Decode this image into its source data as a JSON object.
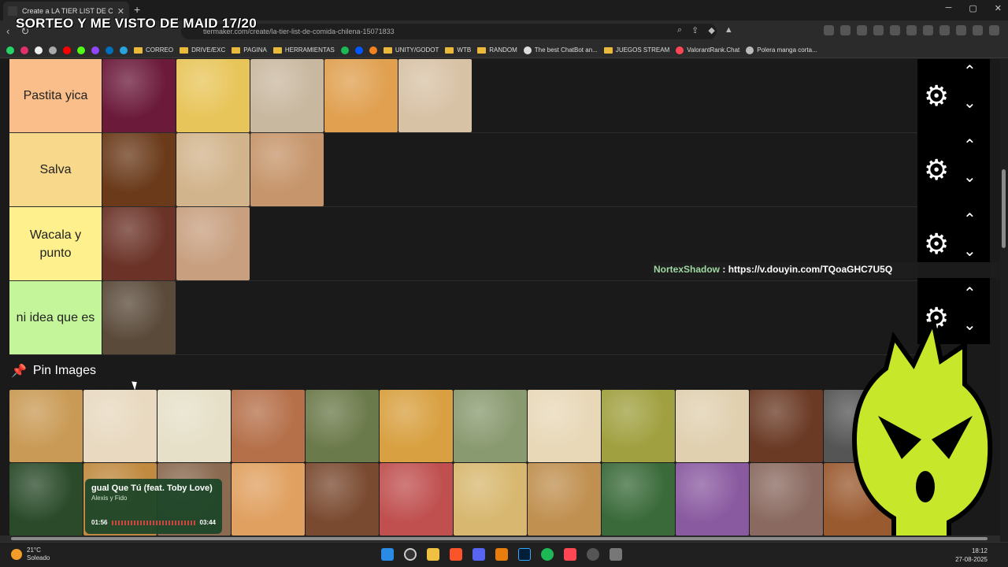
{
  "browser": {
    "tab_title": "Create a LA TIER LIST DE COMID",
    "tab_close": "✕",
    "new_tab": "+",
    "window_controls": [
      "─",
      "▢",
      "✕"
    ],
    "url": "tiermaker.com/create/la-tier-list-de-comida-chilena-15071833",
    "stream_overlay_title": "SORTEO Y ME VISTO DE MAID 17/20"
  },
  "bookmarks": [
    {
      "label": "CORREO",
      "type": "folder"
    },
    {
      "label": "DRIVE/EXC",
      "type": "folder"
    },
    {
      "label": "PAGINA",
      "type": "folder"
    },
    {
      "label": "HERRAMIENTAS",
      "type": "folder"
    },
    {
      "label": "UNITY/GODOT",
      "type": "folder"
    },
    {
      "label": "WTB",
      "type": "folder"
    },
    {
      "label": "RANDOM",
      "type": "folder"
    },
    {
      "label": "The best ChatBot an...",
      "type": "link"
    },
    {
      "label": "JUEGOS STREAM",
      "type": "folder"
    },
    {
      "label": "ValorantRank.Chat",
      "type": "link"
    },
    {
      "label": "Polera manga corta...",
      "type": "link"
    }
  ],
  "tiers": [
    {
      "label": "Pastita yica",
      "color": "#f9be8a",
      "items": [
        "#6b1a3a",
        "#e8c55a",
        "#c9b8a0",
        "#e0a050",
        "#d8c2a6"
      ]
    },
    {
      "label": "Salva",
      "color": "#f8d98b",
      "items": [
        "#6a3a1a",
        "#d2b48c",
        "#c6956b"
      ]
    },
    {
      "label": "Wacala y punto",
      "color": "#fdf08d",
      "items": [
        "#6b3328",
        "#c8a080"
      ]
    },
    {
      "label": "ni idea que es",
      "color": "#c4f59b",
      "items": [
        "#5a4a3a"
      ]
    }
  ],
  "chat_overlay": {
    "user": "NortexShadow",
    "separator": " : ",
    "message": "https://v.douyin.com/TQoaGHC7U5Q"
  },
  "pin": {
    "title": "Pin Images"
  },
  "pin_images": {
    "row1": [
      "#c99a55",
      "#e8d9c0",
      "#e6e0c8",
      "#b5704a",
      "#6b7a4a",
      "#d8a040",
      "#8a9a70",
      "#e8d8b8",
      "#a0a040",
      "#e0d0b0",
      "#6a3a25",
      "#555555"
    ],
    "row2": [
      "#2a4a2a",
      "#c08a40",
      "#8a6a50",
      "#e0a060",
      "#7a4a30",
      "#c05050",
      "#d8b870",
      "#c09050",
      "#3a6a3a",
      "#8a5aa0",
      "#8a6a60",
      "#9a5a30"
    ]
  },
  "music": {
    "song": "gual Que Tú (feat. Toby Love)",
    "artist": "Alexis y Fido",
    "elapsed": "01:56",
    "total": "03:44"
  },
  "taskbar": {
    "temp": "21°C",
    "condition": "Soleado",
    "time": "18:12",
    "date": "27-08-2025"
  }
}
